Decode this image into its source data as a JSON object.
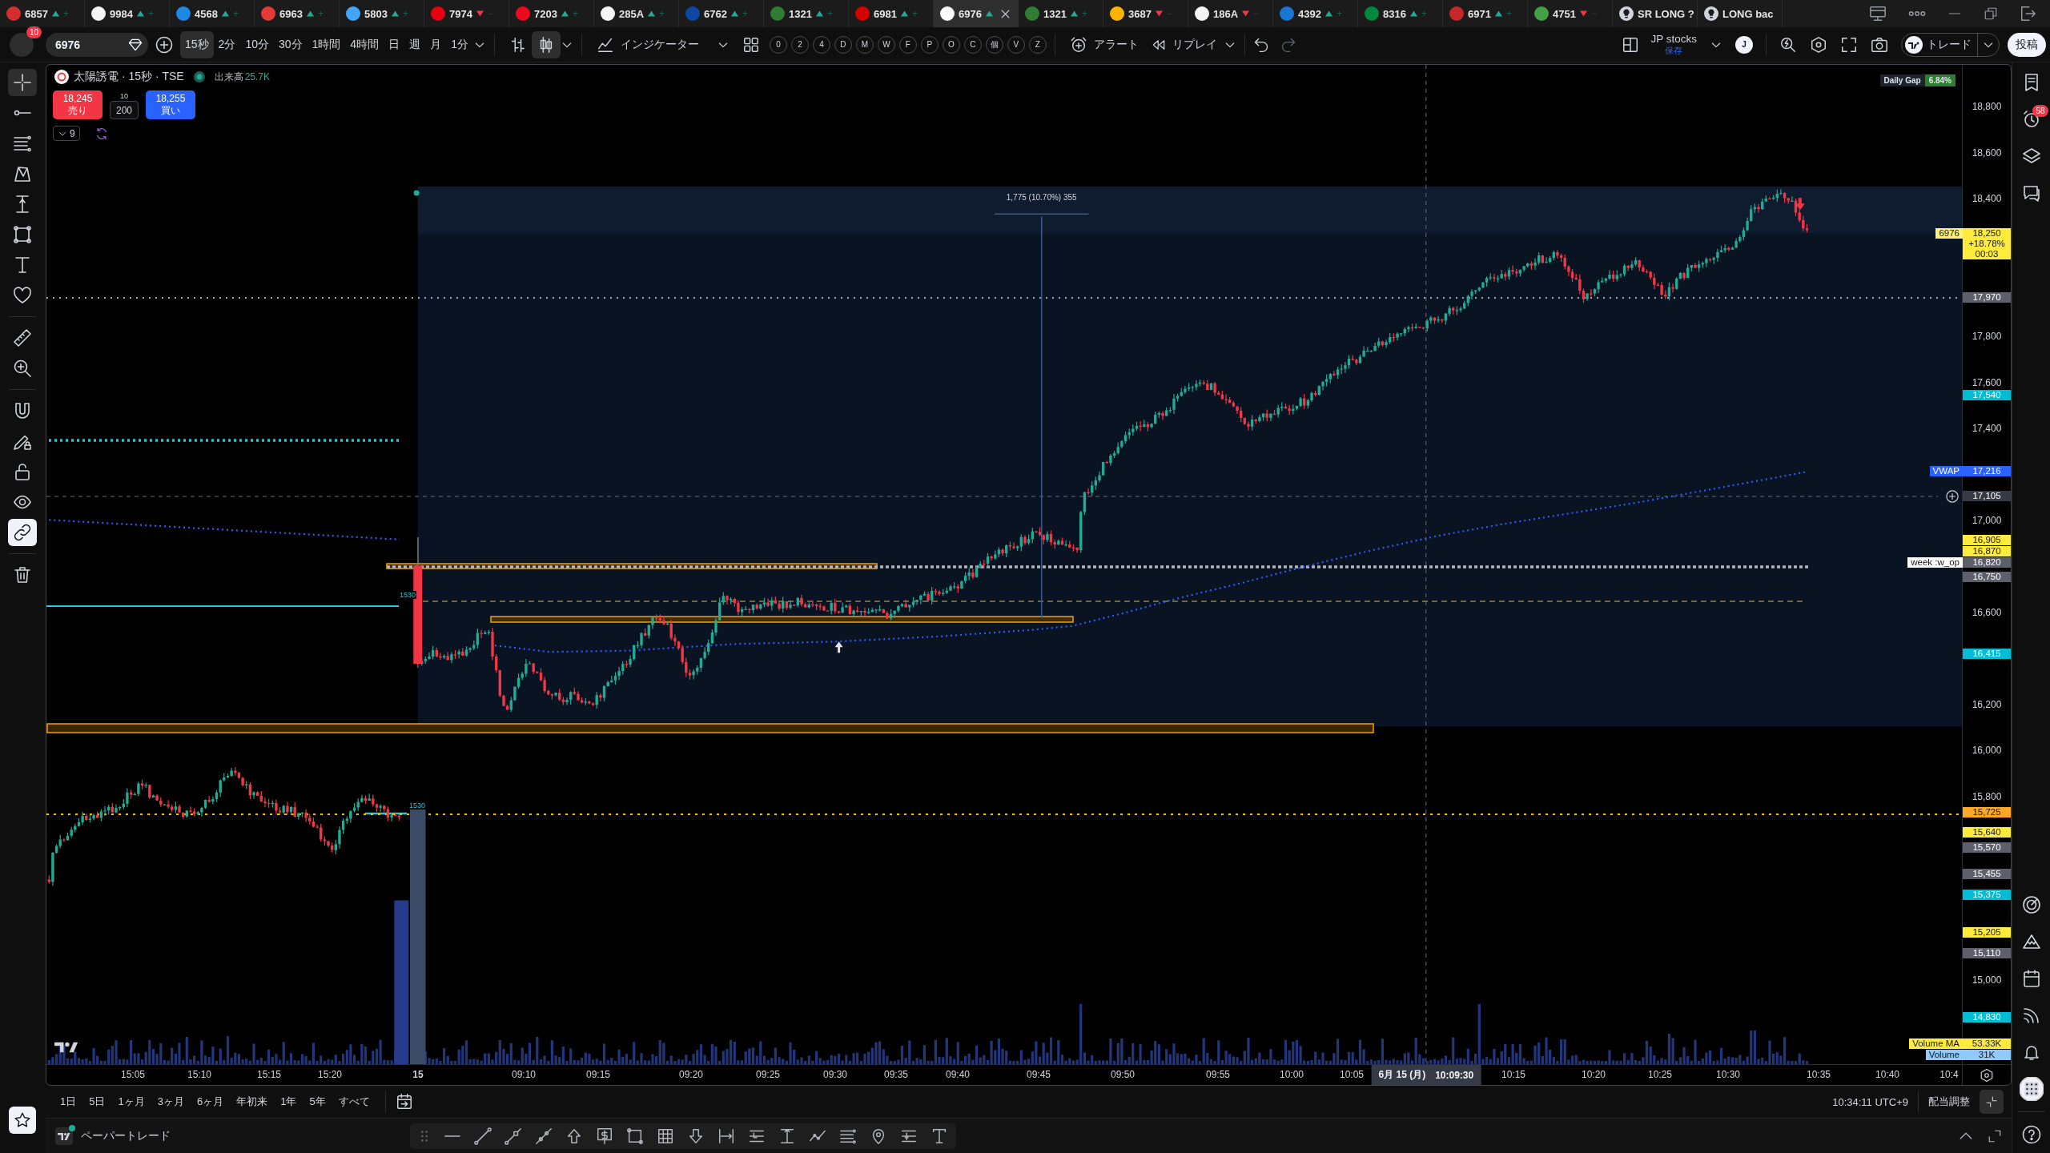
{
  "tabs": [
    {
      "kind": "symbol",
      "label": "6857",
      "rising": true,
      "change": "+",
      "color": "#d32f2f",
      "selected": false
    },
    {
      "kind": "symbol",
      "label": "9984",
      "rising": true,
      "change": "+",
      "color": "#f5f5f5",
      "selected": false
    },
    {
      "kind": "symbol",
      "label": "4568",
      "rising": true,
      "change": "+",
      "color": "#1e88e5",
      "selected": false
    },
    {
      "kind": "symbol",
      "label": "6963",
      "rising": true,
      "change": "+",
      "color": "#e53935",
      "selected": false
    },
    {
      "kind": "symbol",
      "label": "5803",
      "rising": true,
      "change": "+",
      "color": "#42a5f5",
      "selected": false
    },
    {
      "kind": "symbol",
      "label": "7974",
      "rising": false,
      "change": "−",
      "color": "#e60012",
      "selected": false
    },
    {
      "kind": "symbol",
      "label": "7203",
      "rising": true,
      "change": "+",
      "color": "#eb0a1e",
      "selected": false
    },
    {
      "kind": "symbol",
      "label": "285A",
      "rising": true,
      "change": "+",
      "color": "#f5f5f5",
      "selected": false
    },
    {
      "kind": "symbol",
      "label": "6762",
      "rising": true,
      "change": "+",
      "color": "#0d47a1",
      "selected": false
    },
    {
      "kind": "symbol",
      "label": "1321",
      "rising": true,
      "change": "+",
      "color": "#2e7d32",
      "selected": false
    },
    {
      "kind": "symbol",
      "label": "6981",
      "rising": true,
      "change": "+",
      "color": "#d50000",
      "selected": false
    },
    {
      "kind": "symbol",
      "label": "6976",
      "rising": true,
      "color": "#fafafa",
      "selected": true
    },
    {
      "kind": "symbol",
      "label": "1321",
      "rising": true,
      "change": "+",
      "color": "#2e7d32",
      "selected": false
    },
    {
      "kind": "symbol",
      "label": "3687",
      "rising": false,
      "change": "−",
      "color": "#ffb300",
      "selected": false
    },
    {
      "kind": "symbol",
      "label": "186A",
      "rising": false,
      "change": "−",
      "color": "#f5f5f5",
      "selected": false
    },
    {
      "kind": "symbol",
      "label": "4392",
      "rising": true,
      "change": "+",
      "color": "#1976d2",
      "selected": false
    },
    {
      "kind": "symbol",
      "label": "8316",
      "rising": true,
      "change": "+",
      "color": "#00873c",
      "selected": false
    },
    {
      "kind": "symbol",
      "label": "6971",
      "rising": true,
      "change": "+",
      "color": "#c62828",
      "selected": false
    },
    {
      "kind": "symbol",
      "label": "4751",
      "rising": false,
      "change": "−",
      "color": "#43a047",
      "selected": false
    },
    {
      "kind": "layout",
      "label": "SR LONG ?",
      "selected": false
    },
    {
      "kind": "layout",
      "label": "LONG bac",
      "selected": false
    }
  ],
  "account": {
    "notifications": "10"
  },
  "toolbar": {
    "symbol": "6976",
    "intervals": [
      {
        "label": "15秒",
        "selected": true
      },
      {
        "label": "2分",
        "selected": false
      },
      {
        "label": "10分",
        "selected": false
      },
      {
        "label": "30分",
        "selected": false
      },
      {
        "label": "1時間",
        "selected": false
      },
      {
        "label": "4時間",
        "selected": false
      },
      {
        "label": "日",
        "selected": false
      },
      {
        "label": "週",
        "selected": false
      },
      {
        "label": "月",
        "selected": false
      },
      {
        "label": "1分",
        "selected": false
      }
    ],
    "chart_types": [
      {
        "selected": false
      },
      {
        "selected": true
      }
    ],
    "indicators": "インジケーター",
    "shortcuts": [
      "0",
      "2",
      "4",
      "D",
      "M",
      "W",
      "F",
      "P",
      "O",
      "C",
      "個",
      "V",
      "Z"
    ],
    "alert": "アラート",
    "replay": "リプレイ",
    "layout": {
      "name": "JP stocks",
      "status": "保存",
      "user_initial": "J"
    },
    "trade": "トレード",
    "publish": "投稿"
  },
  "left_toolbar": {
    "tools": [
      {
        "selected": true
      },
      {
        "selected": false
      },
      {
        "selected": false
      },
      {
        "selected": false
      },
      {
        "selected": false
      },
      {
        "selected": false
      },
      {
        "selected": false
      },
      {
        "selected": false
      },
      {
        "selected": false
      },
      {
        "selected": false
      }
    ],
    "toggles": [
      {
        "on": false
      },
      {
        "on": false
      },
      {
        "on": false
      },
      {
        "on": false
      },
      {
        "on": true
      }
    ]
  },
  "chart": {
    "legend": {
      "title": "太陽誘電 · 15秒 · TSE",
      "market_open": true,
      "volume_label": "出来高",
      "volume_value": "25.7K"
    },
    "order_panel": {
      "sell_price": "18,245",
      "sell_label": "売り",
      "quantity_step": "10",
      "quantity": "200",
      "buy_price": "18,255",
      "buy_label": "買い"
    },
    "indicator_count": "9",
    "daily_gap": {
      "label": "Daily Gap",
      "value": "6.84%"
    },
    "measure_label": "1,775 (10.70%) 355",
    "line_labels": [
      "1530",
      "1530"
    ]
  },
  "price_axis": {
    "ticks": [
      "18,800",
      "18,600",
      "18,400",
      "17,800",
      "17,600",
      "17,400",
      "17,000",
      "16,600",
      "16,200",
      "16,000",
      "15,800",
      "15,000"
    ],
    "badges": [
      {
        "kind": "price",
        "value": "18,250",
        "details": [
          "+18.78%",
          "00:03"
        ],
        "color": "#ffeb3b",
        "tag": {
          "label": "6976",
          "color": "#fff176"
        }
      },
      {
        "kind": "price",
        "value": "17,970",
        "color": "#5d606b"
      },
      {
        "kind": "price",
        "value": "17,540",
        "color": "#00bcd4"
      },
      {
        "kind": "price",
        "value": "17,216",
        "color": "#2962ff",
        "tag": {
          "label": "VWAP",
          "color": "#2962ff"
        }
      },
      {
        "kind": "crosshair",
        "value": "17,105",
        "color": "#363a45"
      },
      {
        "kind": "price",
        "value": "16,905",
        "color": "#ffeb3b"
      },
      {
        "kind": "price",
        "value": "16,870",
        "color": "#ffeb3b"
      },
      {
        "kind": "price",
        "value": "16,820",
        "color": "#5d606b",
        "tag": {
          "label": "week :w_op",
          "color": "#ffffff"
        }
      },
      {
        "kind": "price",
        "value": "16,750",
        "color": "#5d606b"
      },
      {
        "kind": "price",
        "value": "16,415",
        "color": "#00bcd4"
      },
      {
        "kind": "price",
        "value": "15,725",
        "color": "#ffa726"
      },
      {
        "kind": "price",
        "value": "15,640",
        "color": "#ffeb3b"
      },
      {
        "kind": "price",
        "value": "15,570",
        "color": "#5d606b"
      },
      {
        "kind": "price",
        "value": "15,455",
        "color": "#5d606b"
      },
      {
        "kind": "price",
        "value": "15,375",
        "color": "#00bcd4"
      },
      {
        "kind": "price",
        "value": "15,205",
        "color": "#ffeb3b"
      },
      {
        "kind": "price",
        "value": "15,110",
        "color": "#5d606b"
      },
      {
        "kind": "price",
        "value": "14,830",
        "color": "#00bcd4"
      },
      {
        "kind": "price",
        "value": "53.33K",
        "color": "#ffeb3b",
        "tag": {
          "label": "Volume MA",
          "color": "#ffeb3b"
        }
      },
      {
        "kind": "price",
        "value": "31K",
        "color": "#90caf9",
        "tag": {
          "label": "Volume",
          "color": "#90caf9"
        }
      }
    ]
  },
  "time_axis": {
    "labels": [
      {
        "text": "15:05",
        "kind": "time"
      },
      {
        "text": "15:10",
        "kind": "time"
      },
      {
        "text": "15:15",
        "kind": "time"
      },
      {
        "text": "15:20",
        "kind": "time"
      },
      {
        "text": "15",
        "kind": "day"
      },
      {
        "text": "09:10",
        "kind": "time"
      },
      {
        "text": "09:15",
        "kind": "time"
      },
      {
        "text": "09:20",
        "kind": "time"
      },
      {
        "text": "09:25",
        "kind": "time"
      },
      {
        "text": "09:30",
        "kind": "time"
      },
      {
        "text": "09:35",
        "kind": "time"
      },
      {
        "text": "09:40",
        "kind": "time"
      },
      {
        "text": "09:45",
        "kind": "time"
      },
      {
        "text": "09:50",
        "kind": "time"
      },
      {
        "text": "09:55",
        "kind": "time"
      },
      {
        "text": "10:00",
        "kind": "time"
      },
      {
        "text": "10:05",
        "kind": "time"
      },
      {
        "text": "10:15",
        "kind": "time"
      },
      {
        "text": "10:20",
        "kind": "time"
      },
      {
        "text": "10:25",
        "kind": "time"
      },
      {
        "text": "10:30",
        "kind": "time"
      },
      {
        "text": "10:35",
        "kind": "time"
      },
      {
        "text": "10:40",
        "kind": "time"
      },
      {
        "text": "10:4",
        "kind": "time"
      }
    ],
    "crosshair": {
      "date": "6月 15 (月)",
      "time": "10:09:30"
    }
  },
  "range_bar": {
    "ranges": [
      {
        "label": "1日",
        "selected": false
      },
      {
        "label": "5日",
        "selected": false
      },
      {
        "label": "1ヶ月",
        "selected": false
      },
      {
        "label": "3ヶ月",
        "selected": false
      },
      {
        "label": "6ヶ月",
        "selected": false
      },
      {
        "label": "年初来",
        "selected": false
      },
      {
        "label": "1年",
        "selected": false
      },
      {
        "label": "5年",
        "selected": false
      },
      {
        "label": "すべて",
        "selected": false
      }
    ],
    "clock": "10:34:11 UTC+9",
    "adjustment": "配当調整"
  },
  "bottom_panel": {
    "title": "ペーパートレード",
    "connected": true
  },
  "right_sidebar": {
    "alerts_badge": "58"
  }
}
